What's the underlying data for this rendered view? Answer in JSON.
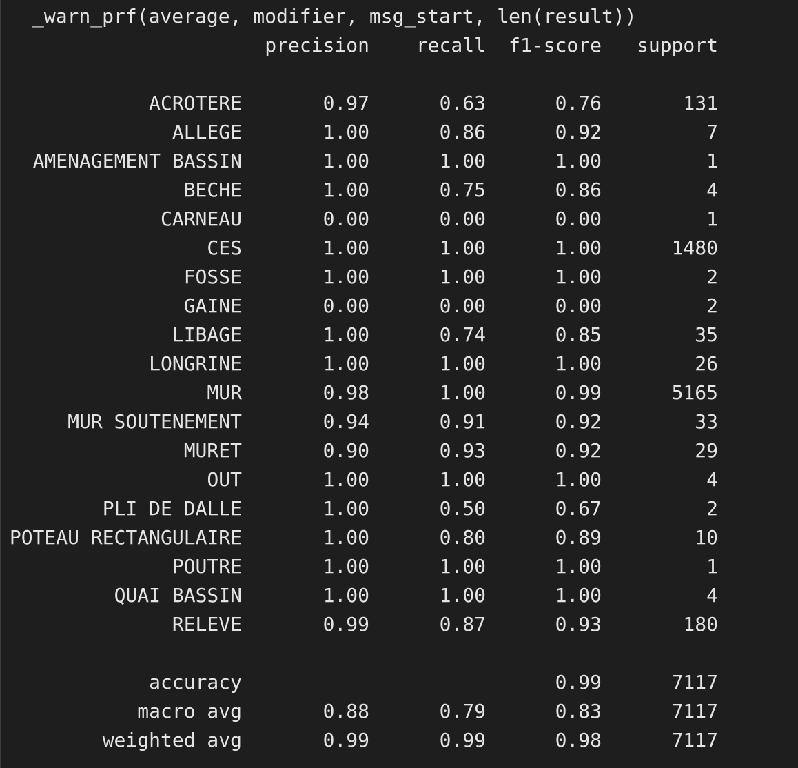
{
  "warning_line": "_warn_prf(average, modifier, msg_start, len(result))",
  "headers": {
    "precision": "precision",
    "recall": "recall",
    "f1": "f1-score",
    "support": "support"
  },
  "rows": [
    {
      "label": "ACROTERE",
      "precision": "0.97",
      "recall": "0.63",
      "f1": "0.76",
      "support": "131"
    },
    {
      "label": "ALLEGE",
      "precision": "1.00",
      "recall": "0.86",
      "f1": "0.92",
      "support": "7"
    },
    {
      "label": "AMENAGEMENT BASSIN",
      "precision": "1.00",
      "recall": "1.00",
      "f1": "1.00",
      "support": "1"
    },
    {
      "label": "BECHE",
      "precision": "1.00",
      "recall": "0.75",
      "f1": "0.86",
      "support": "4"
    },
    {
      "label": "CARNEAU",
      "precision": "0.00",
      "recall": "0.00",
      "f1": "0.00",
      "support": "1"
    },
    {
      "label": "CES",
      "precision": "1.00",
      "recall": "1.00",
      "f1": "1.00",
      "support": "1480"
    },
    {
      "label": "FOSSE",
      "precision": "1.00",
      "recall": "1.00",
      "f1": "1.00",
      "support": "2"
    },
    {
      "label": "GAINE",
      "precision": "0.00",
      "recall": "0.00",
      "f1": "0.00",
      "support": "2"
    },
    {
      "label": "LIBAGE",
      "precision": "1.00",
      "recall": "0.74",
      "f1": "0.85",
      "support": "35"
    },
    {
      "label": "LONGRINE",
      "precision": "1.00",
      "recall": "1.00",
      "f1": "1.00",
      "support": "26"
    },
    {
      "label": "MUR",
      "precision": "0.98",
      "recall": "1.00",
      "f1": "0.99",
      "support": "5165"
    },
    {
      "label": "MUR SOUTENEMENT",
      "precision": "0.94",
      "recall": "0.91",
      "f1": "0.92",
      "support": "33"
    },
    {
      "label": "MURET",
      "precision": "0.90",
      "recall": "0.93",
      "f1": "0.92",
      "support": "29"
    },
    {
      "label": "OUT",
      "precision": "1.00",
      "recall": "1.00",
      "f1": "1.00",
      "support": "4"
    },
    {
      "label": "PLI DE DALLE",
      "precision": "1.00",
      "recall": "0.50",
      "f1": "0.67",
      "support": "2"
    },
    {
      "label": "POTEAU RECTANGULAIRE",
      "precision": "1.00",
      "recall": "0.80",
      "f1": "0.89",
      "support": "10"
    },
    {
      "label": "POUTRE",
      "precision": "1.00",
      "recall": "1.00",
      "f1": "1.00",
      "support": "1"
    },
    {
      "label": "QUAI BASSIN",
      "precision": "1.00",
      "recall": "1.00",
      "f1": "1.00",
      "support": "4"
    },
    {
      "label": "RELEVE",
      "precision": "0.99",
      "recall": "0.87",
      "f1": "0.93",
      "support": "180"
    }
  ],
  "summary": [
    {
      "label": "accuracy",
      "precision": "",
      "recall": "",
      "f1": "0.99",
      "support": "7117"
    },
    {
      "label": "macro avg",
      "precision": "0.88",
      "recall": "0.79",
      "f1": "0.83",
      "support": "7117"
    },
    {
      "label": "weighted avg",
      "precision": "0.99",
      "recall": "0.99",
      "f1": "0.98",
      "support": "7117"
    }
  ],
  "colors": {
    "background": "#1e1e1e",
    "text": "#e4e4e4"
  }
}
